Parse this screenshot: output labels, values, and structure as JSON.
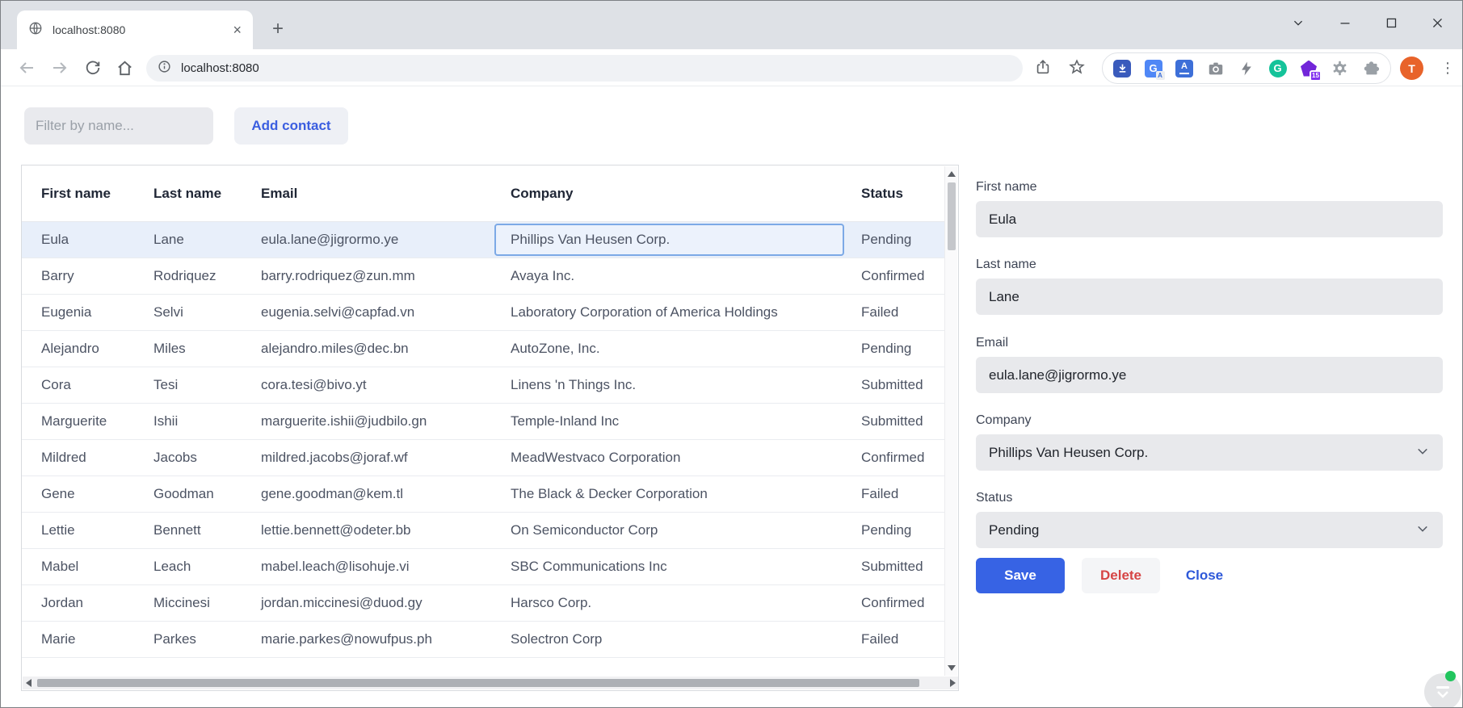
{
  "browser": {
    "tab_title": "localhost:8080",
    "url": "localhost:8080",
    "new_tab_label": "+",
    "extensions_badge": "15",
    "avatar_letter": "T",
    "menu_glyph": "⋮"
  },
  "page": {
    "filter_placeholder": "Filter by name...",
    "add_contact_label": "Add contact",
    "table": {
      "columns": [
        "First name",
        "Last name",
        "Email",
        "Company",
        "Status"
      ],
      "selected_row": 0,
      "selected_column": "company",
      "rows": [
        {
          "first": "Eula",
          "last": "Lane",
          "email": "eula.lane@jigrormo.ye",
          "company": "Phillips Van Heusen Corp.",
          "status": "Pending"
        },
        {
          "first": "Barry",
          "last": "Rodriquez",
          "email": "barry.rodriquez@zun.mm",
          "company": "Avaya Inc.",
          "status": "Confirmed"
        },
        {
          "first": "Eugenia",
          "last": "Selvi",
          "email": "eugenia.selvi@capfad.vn",
          "company": "Laboratory Corporation of America Holdings",
          "status": "Failed"
        },
        {
          "first": "Alejandro",
          "last": "Miles",
          "email": "alejandro.miles@dec.bn",
          "company": "AutoZone, Inc.",
          "status": "Pending"
        },
        {
          "first": "Cora",
          "last": "Tesi",
          "email": "cora.tesi@bivo.yt",
          "company": "Linens 'n Things Inc.",
          "status": "Submitted"
        },
        {
          "first": "Marguerite",
          "last": "Ishii",
          "email": "marguerite.ishii@judbilo.gn",
          "company": "Temple-Inland Inc",
          "status": "Submitted"
        },
        {
          "first": "Mildred",
          "last": "Jacobs",
          "email": "mildred.jacobs@joraf.wf",
          "company": "MeadWestvaco Corporation",
          "status": "Confirmed"
        },
        {
          "first": "Gene",
          "last": "Goodman",
          "email": "gene.goodman@kem.tl",
          "company": "The Black & Decker Corporation",
          "status": "Failed"
        },
        {
          "first": "Lettie",
          "last": "Bennett",
          "email": "lettie.bennett@odeter.bb",
          "company": "On Semiconductor Corp",
          "status": "Pending"
        },
        {
          "first": "Mabel",
          "last": "Leach",
          "email": "mabel.leach@lisohuje.vi",
          "company": "SBC Communications Inc",
          "status": "Submitted"
        },
        {
          "first": "Jordan",
          "last": "Miccinesi",
          "email": "jordan.miccinesi@duod.gy",
          "company": "Harsco Corp.",
          "status": "Confirmed"
        },
        {
          "first": "Marie",
          "last": "Parkes",
          "email": "marie.parkes@nowufpus.ph",
          "company": "Solectron Corp",
          "status": "Failed"
        }
      ]
    },
    "form": {
      "first_name": {
        "label": "First name",
        "value": "Eula"
      },
      "last_name": {
        "label": "Last name",
        "value": "Lane"
      },
      "email": {
        "label": "Email",
        "value": "eula.lane@jigrormo.ye"
      },
      "company": {
        "label": "Company",
        "value": "Phillips Van Heusen Corp."
      },
      "status": {
        "label": "Status",
        "value": "Pending"
      },
      "save_label": "Save",
      "delete_label": "Delete",
      "close_label": "Close"
    },
    "colors": {
      "accent_blue": "#3b5ee0",
      "save_blue": "#3763e4",
      "delete_red": "#d64545",
      "selected_row_bg": "#e8effa",
      "selected_cell_border": "#7ca9e6"
    }
  }
}
